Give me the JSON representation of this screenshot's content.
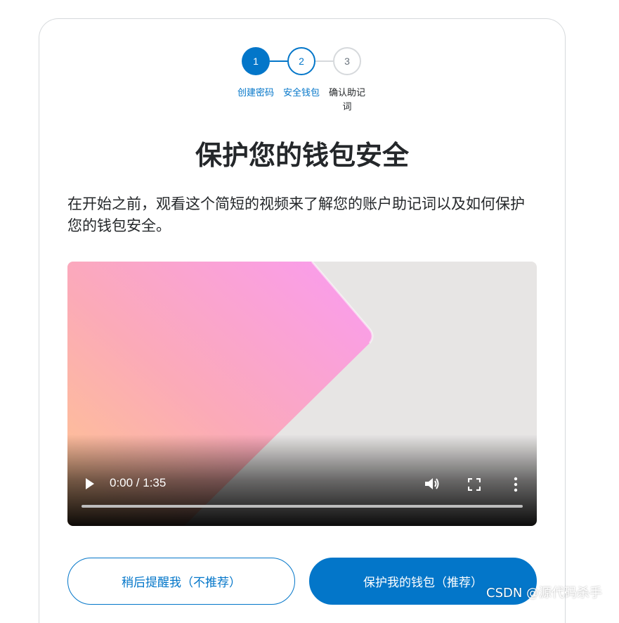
{
  "stepper": {
    "steps": [
      {
        "number": "1",
        "label": "创建密码",
        "state": "completed"
      },
      {
        "number": "2",
        "label": "安全钱包",
        "state": "active"
      },
      {
        "number": "3",
        "label": "确认助记词",
        "state": "pending"
      }
    ]
  },
  "main": {
    "title": "保护您的钱包安全",
    "description": "在开始之前，观看这个简短的视频来了解您的账户助记词以及如何保护您的钱包安全。"
  },
  "video": {
    "time": "0:00 / 1:35",
    "progress": 0,
    "icons": [
      "play-icon",
      "volume-icon",
      "fullscreen-icon",
      "more-vertical-icon"
    ]
  },
  "buttons": {
    "remind_later": "稍后提醒我（不推荐）",
    "secure_wallet": "保护我的钱包（推荐）"
  },
  "watermark": "CSDN @源代码杀手",
  "colors": {
    "primary": "#0376c9",
    "text": "#24272a",
    "border": "#d6d9dc"
  }
}
